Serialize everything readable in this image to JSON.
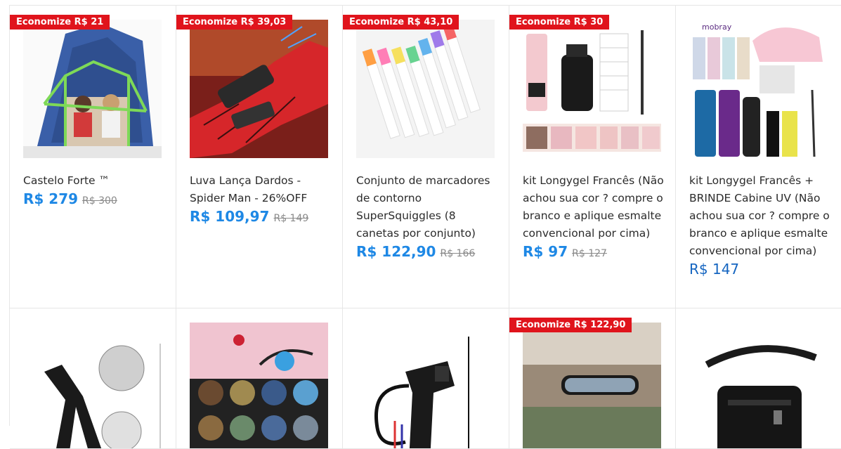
{
  "products": [
    {
      "badge": "Economize R$ 21",
      "title": "Castelo Forte ™",
      "price": "R$ 279",
      "old_price": "R$ 300"
    },
    {
      "badge": "Economize R$ 39,03",
      "title": "Luva Lança Dardos - Spider Man - 26%OFF",
      "price": "R$ 109,97",
      "old_price": "R$ 149"
    },
    {
      "badge": "Economize R$ 43,10",
      "title": "Conjunto de marcadores de contorno SuperSquiggles (8 canetas por conjunto)",
      "price": "R$ 122,90",
      "old_price": "R$ 166"
    },
    {
      "badge": "Economize R$ 30",
      "title": "kit Longygel Francês (Não achou sua cor ? compre o branco e aplique esmalte convencional por cima)",
      "price": "R$ 97",
      "old_price": "R$ 127"
    },
    {
      "title": "kit Longygel Francês + BRINDE Cabine UV (Não achou sua cor ? compre o branco e aplique esmalte convencional por cima)",
      "price": "R$ 147",
      "brand_logo_text": "mobray"
    },
    {},
    {},
    {},
    {
      "badge": "Economize R$ 122,90"
    },
    {}
  ],
  "colors": {
    "badge_bg": "#e0141c",
    "price": "#1e88e5",
    "price_regular": "#1565c0",
    "old_price": "#8a8a8a"
  }
}
